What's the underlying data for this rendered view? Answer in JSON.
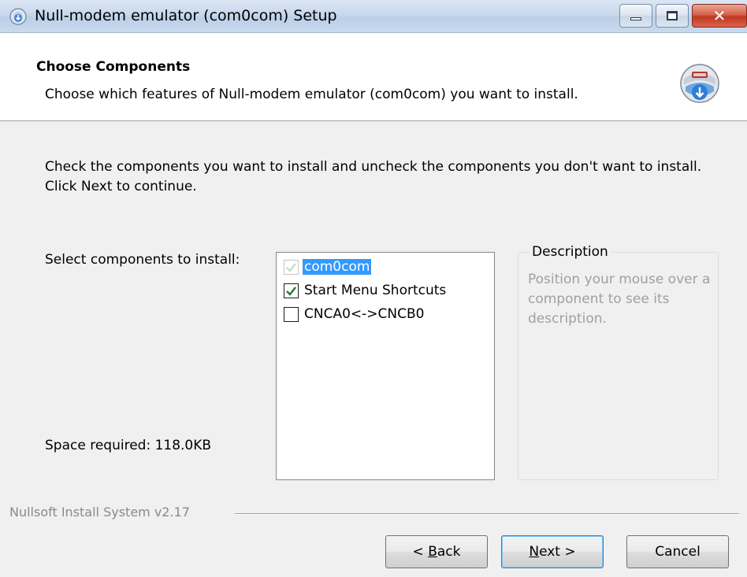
{
  "window": {
    "title": "Null-modem emulator (com0com) Setup",
    "icon": "installer-disc-icon",
    "close_glyph": "✕"
  },
  "header": {
    "title": "Choose Components",
    "subtitle": "Choose which features of Null-modem emulator (com0com) you want to install.",
    "icon": "install-box-icon"
  },
  "body": {
    "intro": "Check the components you want to install and uncheck the components you don't want to install. Click Next to continue.",
    "select_label": "Select components to install:",
    "space_required": "Space required: 118.0KB"
  },
  "components": [
    {
      "label": "com0com",
      "checked": true,
      "disabled": true,
      "selected": true
    },
    {
      "label": "Start Menu Shortcuts",
      "checked": true,
      "disabled": false,
      "selected": false
    },
    {
      "label": "CNCA0<->CNCB0",
      "checked": false,
      "disabled": false,
      "selected": false
    }
  ],
  "description": {
    "legend": "Description",
    "text": "Position your mouse over a component to see its description."
  },
  "footer": {
    "branding": "Nullsoft Install System v2.17",
    "buttons": {
      "back": {
        "pre": "< ",
        "mnemonic": "B",
        "post": "ack"
      },
      "next": {
        "pre": "",
        "mnemonic": "N",
        "post": "ext >"
      },
      "cancel": "Cancel"
    }
  },
  "colors": {
    "selection": "#3399ff",
    "checkmark": "#1d7a2e",
    "disabled_text": "#a0a0a0",
    "close_button": "#c0381f"
  }
}
